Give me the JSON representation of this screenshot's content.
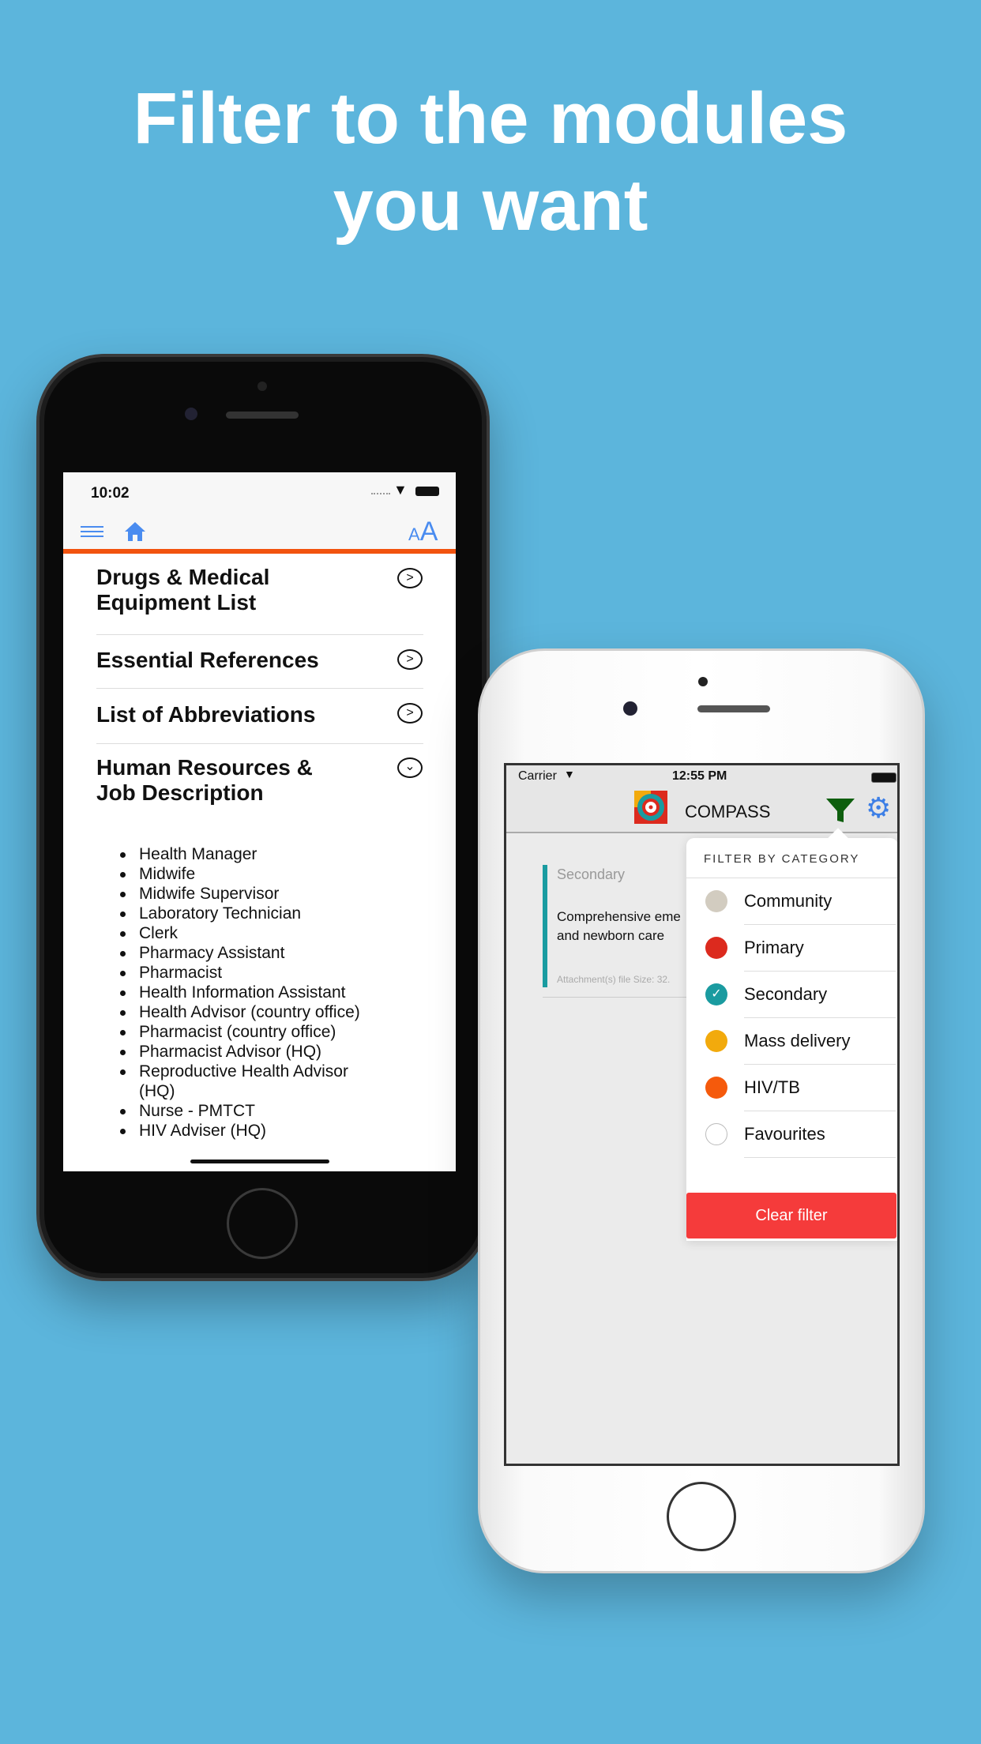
{
  "headline": {
    "line1": "Filter to the modules",
    "line2": "you want"
  },
  "left_phone": {
    "status": {
      "time": "10:02"
    },
    "toolbar": {
      "menu_icon": "hamburger-icon",
      "home_icon": "home-icon",
      "font_size_label_small": "A",
      "font_size_label_large": "A",
      "accent": "#4a8cf0",
      "divider_color": "#f2530f"
    },
    "items": [
      {
        "line1": "Drugs & Medical",
        "line2": "Equipment List",
        "state": "collapsed"
      },
      {
        "line1": "Essential References",
        "state": "collapsed"
      },
      {
        "line1": "List of Abbreviations",
        "state": "collapsed"
      },
      {
        "line1": "Human Resources &",
        "line2": "Job Description",
        "state": "expanded"
      }
    ],
    "sub_items": [
      "Health Manager",
      "Midwife",
      "Midwife Supervisor",
      "Laboratory Technician",
      "Clerk",
      "Pharmacy Assistant",
      "Pharmacist",
      "Health Information Assistant",
      "Health Advisor (country office)",
      "Pharmacist (country office)",
      "Pharmacist Advisor (HQ)",
      "Reproductive Health Advisor (HQ)",
      "Nurse - PMTCT",
      "HIV Adviser (HQ)"
    ]
  },
  "right_phone": {
    "status": {
      "carrier": "Carrier",
      "time": "12:55 PM"
    },
    "nav": {
      "title": "COMPASS",
      "filter_icon": "filter-icon",
      "settings_icon": "gear-icon"
    },
    "card": {
      "category": "Secondary",
      "title_line1": "Comprehensive eme",
      "title_line2": "and newborn care",
      "meta": "Attachment(s) file Size: 32."
    },
    "filter": {
      "header": "FILTER BY CATEGORY",
      "options": [
        {
          "label": "Community",
          "color": "#d2ccc0",
          "checked": false
        },
        {
          "label": "Primary",
          "color": "#dc2a1e",
          "checked": false
        },
        {
          "label": "Secondary",
          "color": "#1a9ba0",
          "checked": true
        },
        {
          "label": "Mass delivery",
          "color": "#f2aa0c",
          "checked": false
        },
        {
          "label": "HIV/TB",
          "color": "#f55a0c",
          "checked": false
        },
        {
          "label": "Favourites",
          "color": "#ffffff",
          "checked": false
        }
      ],
      "clear_label": "Clear filter",
      "clear_color": "#f53b3b"
    }
  }
}
